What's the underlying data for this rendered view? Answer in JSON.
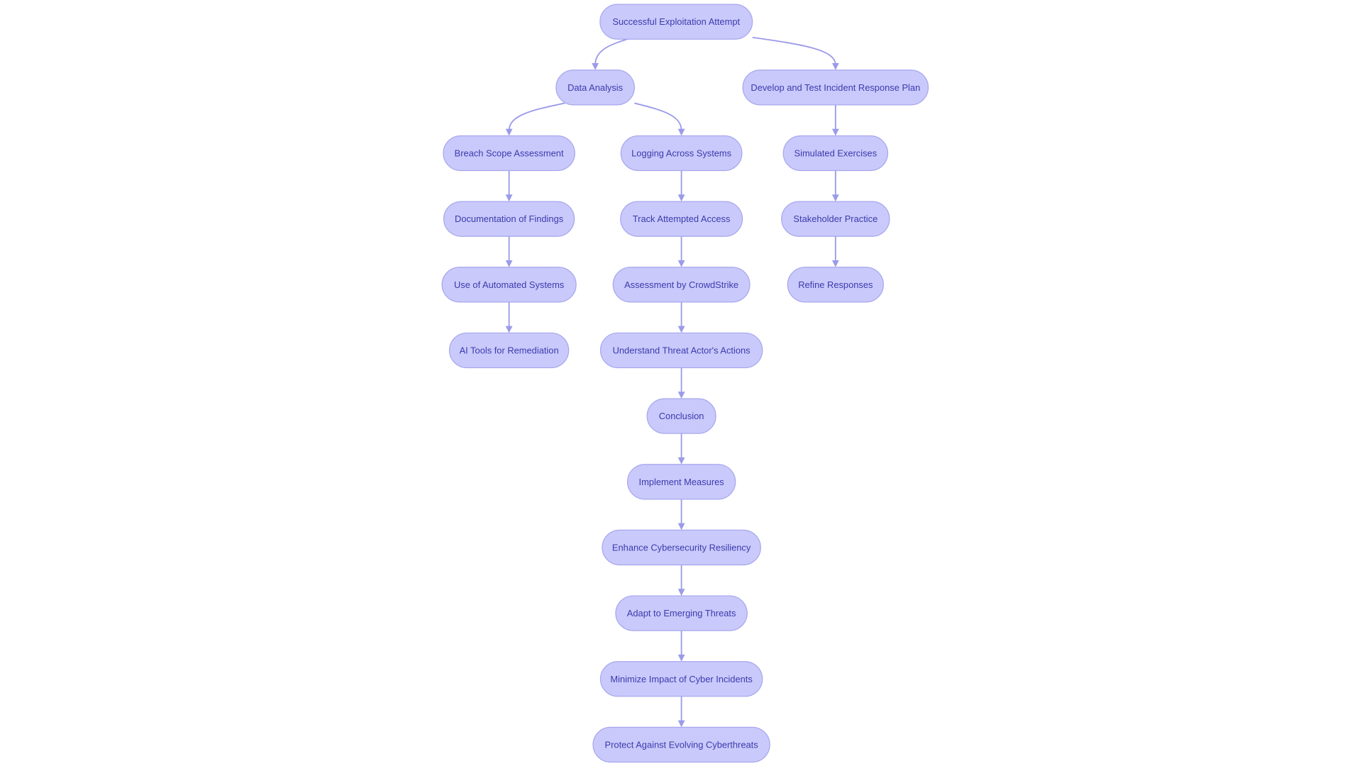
{
  "diagram": {
    "type": "flowchart",
    "direction": "top-down",
    "colors": {
      "node_fill": "#c9c9fb",
      "node_stroke": "#a7a7ee",
      "text": "#3b3bae",
      "edge": "#9b9be8"
    },
    "nodes": [
      {
        "id": "start",
        "label": "Successful Exploitation Attempt"
      },
      {
        "id": "data",
        "label": "Data Analysis"
      },
      {
        "id": "plan",
        "label": "Develop and Test Incident Response Plan"
      },
      {
        "id": "breach",
        "label": "Breach Scope Assessment"
      },
      {
        "id": "logging",
        "label": "Logging Across Systems"
      },
      {
        "id": "sim",
        "label": "Simulated Exercises"
      },
      {
        "id": "doc",
        "label": "Documentation of Findings"
      },
      {
        "id": "track",
        "label": "Track Attempted Access"
      },
      {
        "id": "stake",
        "label": "Stakeholder Practice"
      },
      {
        "id": "auto",
        "label": "Use of Automated Systems"
      },
      {
        "id": "crowd",
        "label": "Assessment by CrowdStrike"
      },
      {
        "id": "refine",
        "label": "Refine Responses"
      },
      {
        "id": "ai",
        "label": "AI Tools for Remediation"
      },
      {
        "id": "threat",
        "label": "Understand Threat Actor's Actions"
      },
      {
        "id": "concl",
        "label": "Conclusion"
      },
      {
        "id": "impl",
        "label": "Implement Measures"
      },
      {
        "id": "enh",
        "label": "Enhance Cybersecurity Resiliency"
      },
      {
        "id": "adapt",
        "label": "Adapt to Emerging Threats"
      },
      {
        "id": "min",
        "label": "Minimize Impact of Cyber Incidents"
      },
      {
        "id": "prot",
        "label": "Protect Against Evolving Cyberthreats"
      }
    ],
    "edges": [
      [
        "start",
        "data"
      ],
      [
        "start",
        "plan"
      ],
      [
        "data",
        "breach"
      ],
      [
        "data",
        "logging"
      ],
      [
        "plan",
        "sim"
      ],
      [
        "sim",
        "stake"
      ],
      [
        "stake",
        "refine"
      ],
      [
        "breach",
        "doc"
      ],
      [
        "doc",
        "auto"
      ],
      [
        "auto",
        "ai"
      ],
      [
        "logging",
        "track"
      ],
      [
        "track",
        "crowd"
      ],
      [
        "crowd",
        "threat"
      ],
      [
        "threat",
        "concl"
      ],
      [
        "concl",
        "impl"
      ],
      [
        "impl",
        "enh"
      ],
      [
        "enh",
        "adapt"
      ],
      [
        "adapt",
        "min"
      ],
      [
        "min",
        "prot"
      ]
    ]
  }
}
